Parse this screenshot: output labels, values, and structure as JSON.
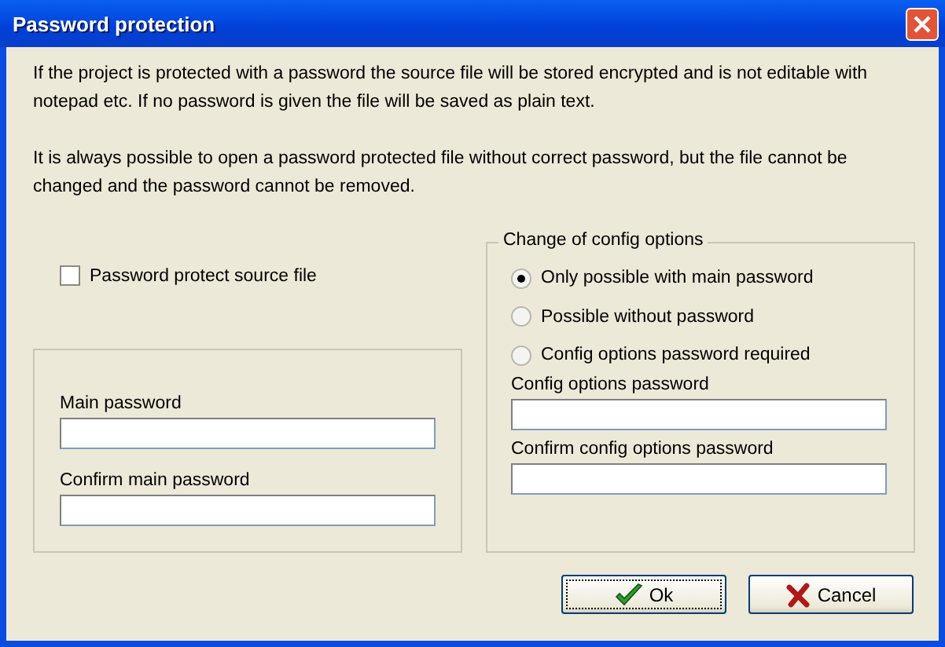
{
  "window": {
    "title": "Password protection"
  },
  "paragraphs": [
    "If the project is protected with a password the source file will be stored encrypted and is not editable with notepad etc. If no password is given the file will be saved as plain text.",
    "It is always possible to open a password protected file without correct password, but the file cannot be changed and the password cannot be removed."
  ],
  "protect_checkbox": {
    "label": "Password protect source file",
    "checked": false
  },
  "main_group": {
    "fields": [
      {
        "label": "Main password"
      },
      {
        "label": "Confirm main password"
      }
    ]
  },
  "config_group": {
    "title": "Change of config options",
    "options": [
      {
        "label": "Only possible with main password",
        "selected": true
      },
      {
        "label": "Possible without password",
        "selected": false
      },
      {
        "label": "Config options password required",
        "selected": false
      }
    ],
    "fields": [
      {
        "label": "Config options password"
      },
      {
        "label": "Confirm config options password"
      }
    ]
  },
  "buttons": [
    {
      "label": "Ok",
      "kind": "ok",
      "focused": true
    },
    {
      "label": "Cancel",
      "kind": "cancel",
      "focused": false
    }
  ]
}
